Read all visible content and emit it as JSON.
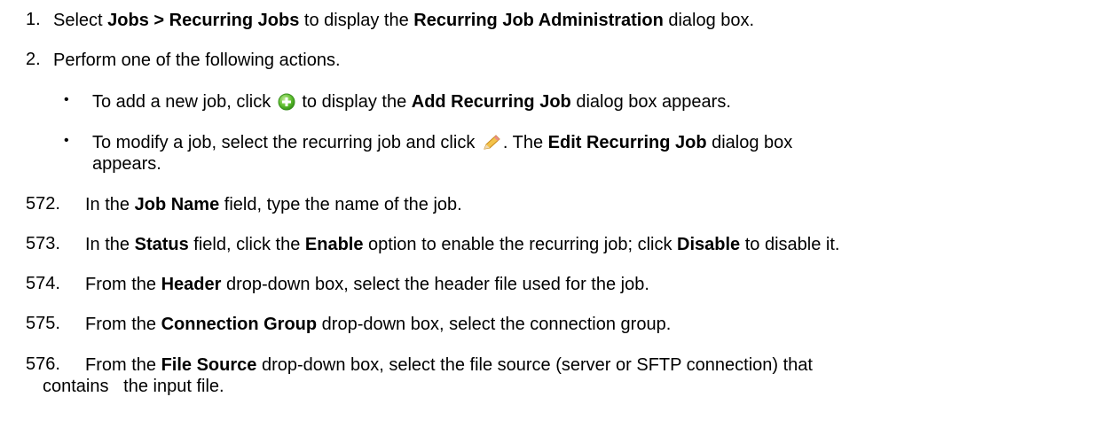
{
  "steps": [
    {
      "num": "1.",
      "parts": [
        "Select ",
        "Jobs > Recurring Jobs",
        " to display the ",
        "Recurring Job Administration",
        " dialog box."
      ]
    },
    {
      "num": "2.",
      "text": "Perform one of the following actions."
    },
    {
      "num": "572.",
      "parts": [
        "In the ",
        "Job Name",
        " field, type the name of the job."
      ]
    },
    {
      "num": "573.",
      "parts": [
        "In the ",
        "Status",
        " field, click the ",
        "Enable",
        " option to enable the recurring job; click ",
        "Disable",
        " to disable it."
      ]
    },
    {
      "num": "574.",
      "parts": [
        "From the ",
        "Header",
        " drop-down box, select the header file used for the job."
      ]
    },
    {
      "num": "575.",
      "parts": [
        "From the ",
        "Connection Group",
        " drop-down box, select the connection group."
      ]
    },
    {
      "num": "576.",
      "parts": [
        "From the ",
        "File Source",
        " drop-down box, select the file source (server or SFTP connection) that"
      ],
      "cont": "contains   the input file."
    }
  ],
  "bullets": [
    {
      "parts": [
        "To add a new job, click ",
        " to display the ",
        "Add Recurring Job",
        " dialog box appears."
      ],
      "icon": "add-icon"
    },
    {
      "parts": [
        "To modify a job, select the recurring job and click ",
        ". The ",
        "Edit Recurring Job",
        " dialog box"
      ],
      "cont": "appears.",
      "icon": "edit-pencil-icon"
    }
  ],
  "bullet_symbol": "•"
}
